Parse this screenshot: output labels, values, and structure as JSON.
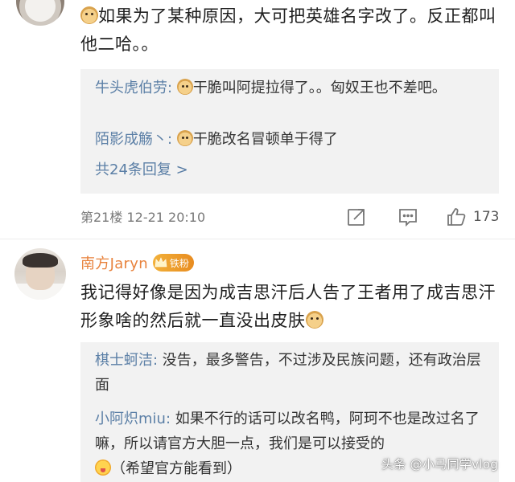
{
  "comment1": {
    "text": "如果为了某种原因，大可把英雄名字改了。反正都叫他二哈。。",
    "replies": [
      {
        "name": "牛头虎伯劳:",
        "text": "干脆叫阿提拉得了。。匈奴王也不差吧。"
      },
      {
        "name": "陌影成觞丶:",
        "text": "干脆改名冒顿单于得了"
      }
    ],
    "more_replies": "共24条回复 >",
    "floor": "第21楼",
    "time": "12-21 20:10",
    "likes": "173"
  },
  "comment2": {
    "author": "南方Jaryn",
    "badge": "铁粉",
    "text": "我记得好像是因为成吉思汗后人告了王者用了成吉思汗形象啥的然后就一直没出皮肤",
    "replies": [
      {
        "name": "棋士蚵洁:",
        "text": " 没告，最多警告，不过涉及民族问题，还有政治层面"
      },
      {
        "name": "小阿炽miu:",
        "text": " 如果不行的话可以改名鸭，阿珂不也是改过名了嘛，所以请官方大胆一点，我们是可以接受的"
      },
      {
        "name": "",
        "text": "（希望官方能看到）"
      }
    ]
  },
  "watermark": "头条 @小马同学vlog",
  "colors": {
    "link_blue": "#5b7fa6",
    "username_orange": "#e8823c",
    "reply_bg": "#f2f2f2"
  },
  "icons": [
    "doge-emoji",
    "share-icon",
    "comment-icon",
    "like-icon",
    "crown-icon",
    "tongue-emoji"
  ]
}
